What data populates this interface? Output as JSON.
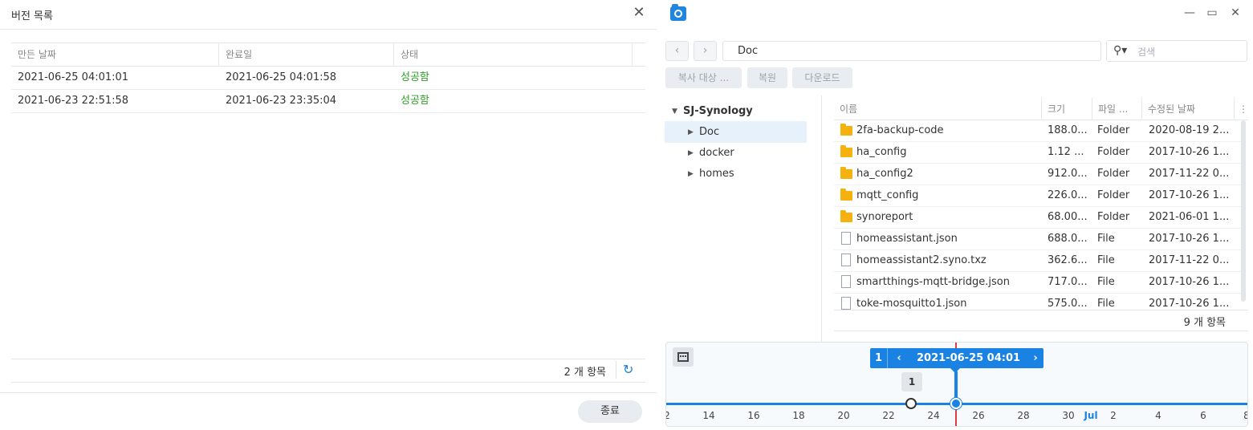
{
  "left_dialog": {
    "title": "버전 목록",
    "close_icon": "✕",
    "columns": [
      "만든 날짜",
      "완료일",
      "상태"
    ],
    "rows": [
      {
        "created": "2021-06-25 04:01:01",
        "completed": "2021-06-25 04:01:58",
        "status": "성공함"
      },
      {
        "created": "2021-06-23 22:51:58",
        "completed": "2021-06-23 23:35:04",
        "status": "성공함"
      }
    ],
    "count": "2 개 항목",
    "refresh_icon": "↻",
    "close_button": "종료",
    "status_color": "#2f9e26"
  },
  "right_window": {
    "window_controls": {
      "minimize": "—",
      "maximize": "▭",
      "close": "✕"
    },
    "back_icon": "‹",
    "forward_icon": "›",
    "path": "Doc",
    "search_placeholder": "검색",
    "search_icon": "⚲▾",
    "toolbar": {
      "copy_to": "복사 대상 ...",
      "restore": "복원",
      "download": "다운로드"
    },
    "tree": {
      "root": "SJ-Synology",
      "items": [
        "Doc",
        "docker",
        "homes"
      ]
    },
    "columns": [
      "이름",
      "크기",
      "파일 ...",
      "수정된 날짜"
    ],
    "column_menu_icon": "⋮",
    "files": [
      {
        "name": "2fa-backup-code",
        "size": "188.0...",
        "type": "Folder",
        "modified": "2020-08-19 2...",
        "kind": "folder"
      },
      {
        "name": "ha_config",
        "size": "1.12 ...",
        "type": "Folder",
        "modified": "2017-10-26 1...",
        "kind": "folder"
      },
      {
        "name": "ha_config2",
        "size": "912.0...",
        "type": "Folder",
        "modified": "2017-11-22 0...",
        "kind": "folder"
      },
      {
        "name": "mqtt_config",
        "size": "226.0...",
        "type": "Folder",
        "modified": "2017-10-26 1...",
        "kind": "folder"
      },
      {
        "name": "synoreport",
        "size": "68.00...",
        "type": "Folder",
        "modified": "2021-06-01 1...",
        "kind": "folder"
      },
      {
        "name": "homeassistant.json",
        "size": "688.0...",
        "type": "File",
        "modified": "2017-10-26 1...",
        "kind": "file"
      },
      {
        "name": "homeassistant2.syno.txz",
        "size": "362.6...",
        "type": "File",
        "modified": "2017-11-22 0...",
        "kind": "file"
      },
      {
        "name": "smartthings-mqtt-bridge.json",
        "size": "717.0...",
        "type": "File",
        "modified": "2017-10-26 1...",
        "kind": "file"
      },
      {
        "name": "toke-mosquitto1.json",
        "size": "575.0...",
        "type": "File",
        "modified": "2017-10-26 1...",
        "kind": "file"
      }
    ],
    "count": "9 개 항목",
    "timeline": {
      "version_count": "1",
      "prev_icon": "‹",
      "next_icon": "›",
      "datetime": "2021-06-25 04:01",
      "cluster_count": "1",
      "ticks": [
        "2",
        "14",
        "16",
        "18",
        "20",
        "22",
        "24",
        "26",
        "28",
        "30",
        "Jul",
        "2",
        "4",
        "6",
        "8"
      ],
      "accent": "#1a82e2",
      "marker_color": "#e23c3c"
    }
  }
}
